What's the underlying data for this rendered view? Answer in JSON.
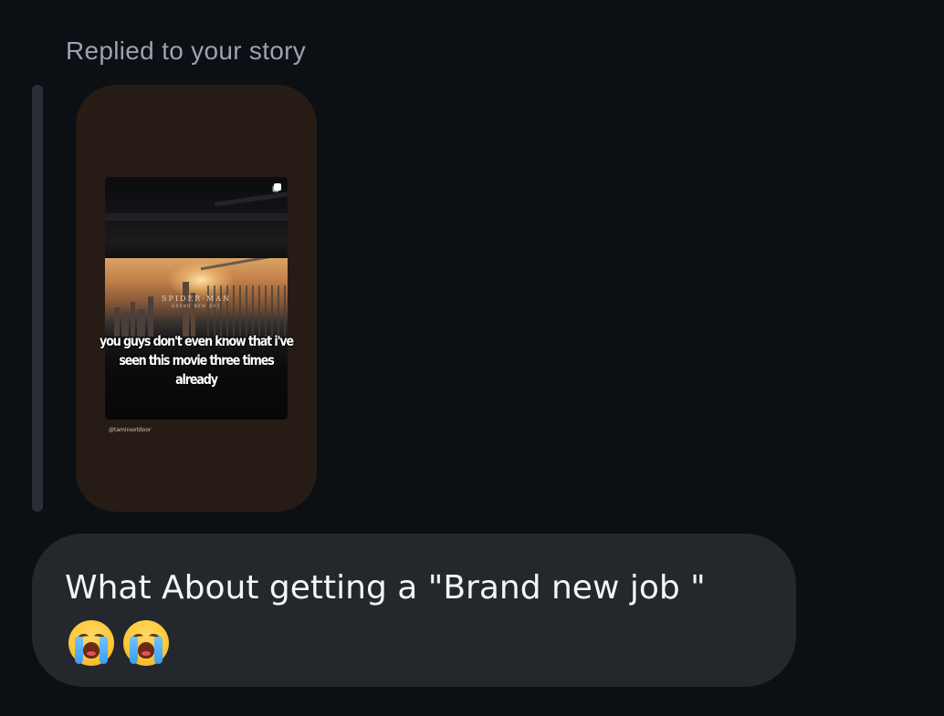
{
  "thread": {
    "reply_context_label": "Replied to your story"
  },
  "story": {
    "movie_title": "SPIDER-MAN",
    "movie_subtitle": "BRAND NEW DAY",
    "caption": "you guys don't even know that i've\nseen this movie three times already",
    "username": "@taminextdoor"
  },
  "message": {
    "text": "What About getting a \"Brand new job \"",
    "emoji_count": 2,
    "emoji_icon": "loudly-crying-face-emoji"
  },
  "colors": {
    "background": "#0c0f14",
    "bubble": "#24282d",
    "story_card": "#271c15",
    "reply_label": "#9aa3ad",
    "message_text": "#f4f5f6"
  }
}
